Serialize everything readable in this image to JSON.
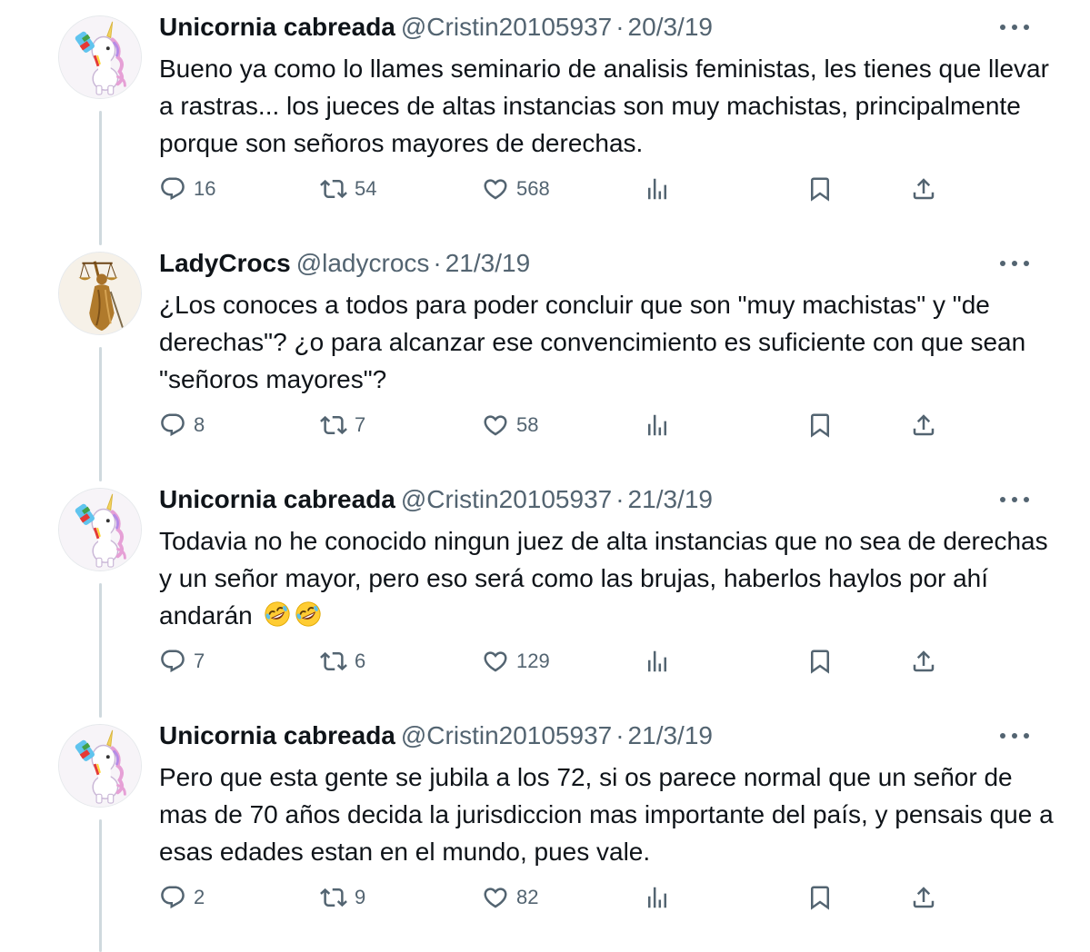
{
  "colors": {
    "text_primary": "#0f1419",
    "text_secondary": "#536471",
    "thread_line": "#cfd9de",
    "background": "#ffffff"
  },
  "tweets": [
    {
      "display_name": "Unicornia cabreada",
      "handle": "@Cristin20105937",
      "separator": "·",
      "date": "20/3/19",
      "avatar_icon": "unicorn-avatar",
      "text": "Bueno ya como lo llames seminario de analisis feministas, les tienes que llevar a rastras... los jueces de altas instancias son muy machistas, principalmente porque son señoros mayores de derechas.",
      "replies": "16",
      "retweets": "54",
      "likes": "568"
    },
    {
      "display_name": "LadyCrocs",
      "handle": "@ladycrocs",
      "separator": "·",
      "date": "21/3/19",
      "avatar_icon": "lady-justice-avatar",
      "text": "¿Los conoces a todos para poder concluir que son \"muy machistas\" y \"de derechas\"? ¿o para alcanzar ese convencimiento es suficiente con que sean \"señoros mayores\"?",
      "replies": "8",
      "retweets": "7",
      "likes": "58"
    },
    {
      "display_name": "Unicornia cabreada",
      "handle": "@Cristin20105937",
      "separator": "·",
      "date": "21/3/19",
      "avatar_icon": "unicorn-avatar",
      "text": "Todavia no he conocido ningun juez de alta instancias que no sea de derechas y un señor mayor, pero eso será como las brujas, haberlos haylos por ahí andarán",
      "text_emoji": "rolling-on-floor-laughing-emoji x2",
      "replies": "7",
      "retweets": "6",
      "likes": "129"
    },
    {
      "display_name": "Unicornia cabreada",
      "handle": "@Cristin20105937",
      "separator": "·",
      "date": "21/3/19",
      "avatar_icon": "unicorn-avatar",
      "text": "Pero que esta gente se jubila a los 72, si os parece normal que un señor de mas de 70 años decida la jurisdiccion mas importante del país, y pensais que a esas edades estan en el mundo, pues vale.",
      "replies": "2",
      "retweets": "9",
      "likes": "82"
    }
  ]
}
